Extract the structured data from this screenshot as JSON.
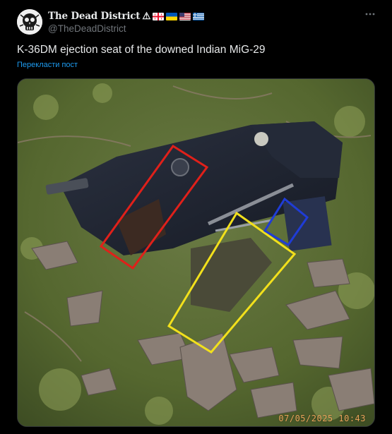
{
  "author": {
    "display_name": "The Dead District",
    "handle": "@TheDeadDistrict",
    "suffix_symbol": "⚠",
    "flags": [
      "georgia-flag",
      "ukraine-flag",
      "usa-flag",
      "greece-flag"
    ]
  },
  "post": {
    "text": "K-36DM ejection seat of the downed Indian MiG-29",
    "translate_label": "Перекласти пост"
  },
  "media": {
    "timestamp": "07/05/2025  10:43",
    "annotation_colors": {
      "red": "#e0201a",
      "yellow": "#f2e01c",
      "blue": "#1f3cd6"
    }
  },
  "icons": {
    "more": "more-horizontal-icon",
    "avatar": "skull-avatar-icon"
  },
  "colors": {
    "background": "#000000",
    "text": "#e7e9ea",
    "muted": "#71767b",
    "link": "#1d9bf0"
  }
}
